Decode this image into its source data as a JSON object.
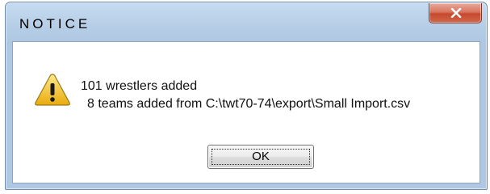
{
  "window": {
    "title": "NOTICE",
    "close_icon": "close-x-icon"
  },
  "message": {
    "icon": "warning-triangle-icon",
    "line1": "101 wrestlers added",
    "line2": "8 teams added from C:\\twt70-74\\export\\Small Import.csv"
  },
  "buttons": {
    "ok_label": "OK"
  },
  "colors": {
    "frame": "#b6cde6",
    "close_button": "#c6482c",
    "warning_yellow": "#f3c619"
  }
}
